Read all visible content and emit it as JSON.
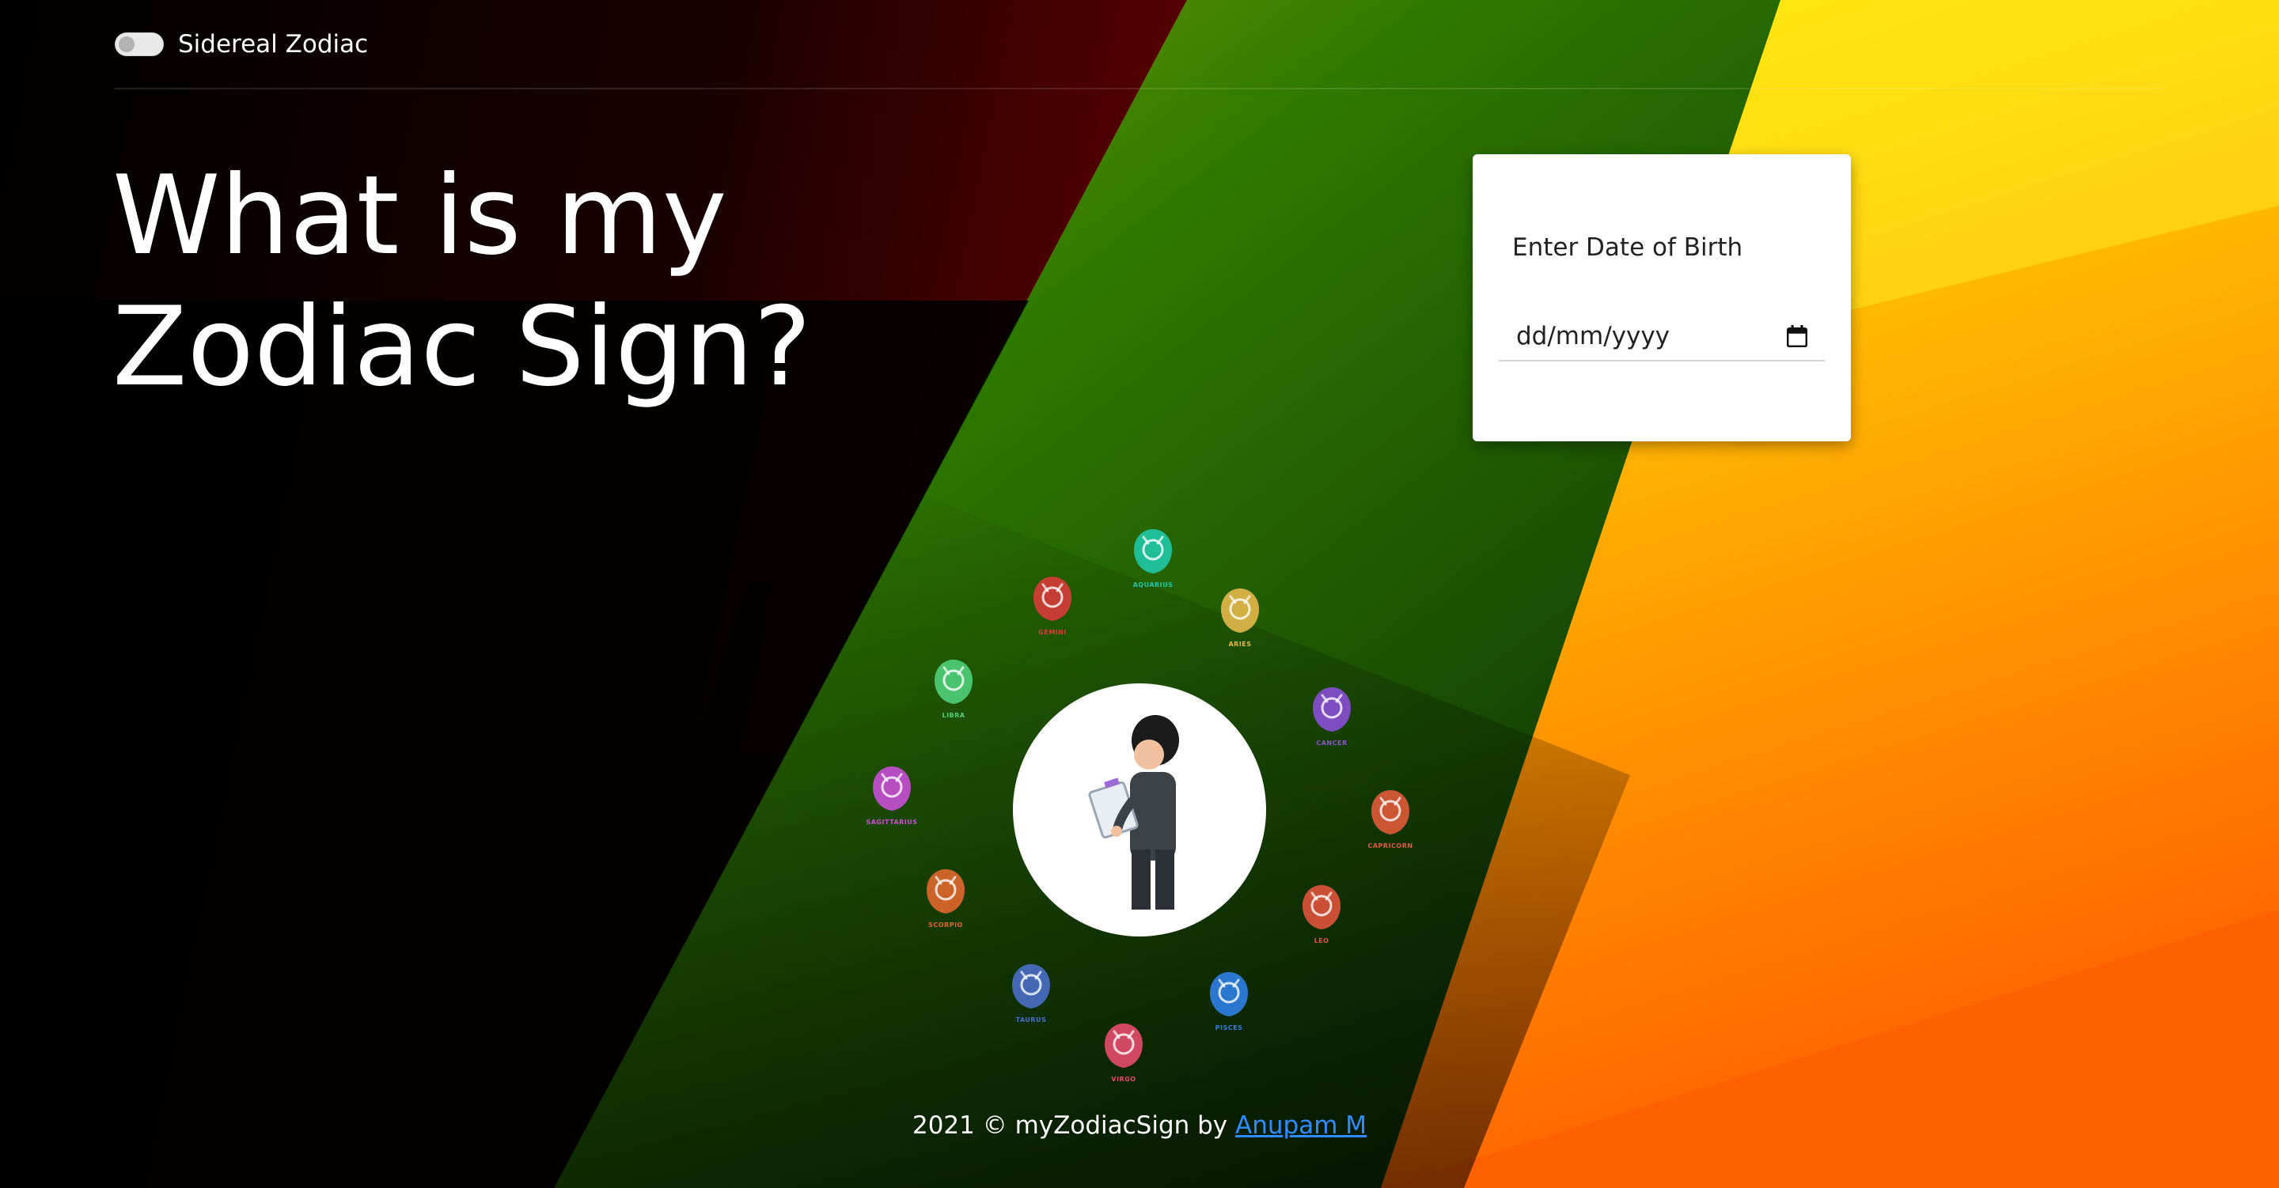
{
  "header": {
    "toggle_label": "Sidereal Zodiac",
    "toggle_on": false
  },
  "hero": {
    "title": "What is my Zodiac Sign?"
  },
  "dob_card": {
    "label": "Enter Date of Birth",
    "placeholder": "dd/mm/yyyy",
    "value": ""
  },
  "signs": [
    {
      "name": "AQUARIUS",
      "color": "#1fc7a8"
    },
    {
      "name": "ARIES",
      "color": "#e6b84a"
    },
    {
      "name": "CANCER",
      "color": "#8a4fd6"
    },
    {
      "name": "CAPRICORN",
      "color": "#e05a3a"
    },
    {
      "name": "LEO",
      "color": "#e0533a"
    },
    {
      "name": "PISCES",
      "color": "#2f7fe6"
    },
    {
      "name": "VIRGO",
      "color": "#e64b6b"
    },
    {
      "name": "TAURUS",
      "color": "#4a6fc8"
    },
    {
      "name": "SCORPIO",
      "color": "#e0672c"
    },
    {
      "name": "SAGITTARIUS",
      "color": "#c84fd6"
    },
    {
      "name": "LIBRA",
      "color": "#4fcf7a"
    },
    {
      "name": "GEMINI",
      "color": "#d83a3a"
    }
  ],
  "footer": {
    "text": "2021 © myZodiacSign by",
    "author": "Anupam M"
  },
  "colors": {
    "link": "#2f8cff",
    "card_bg": "#ffffff"
  }
}
